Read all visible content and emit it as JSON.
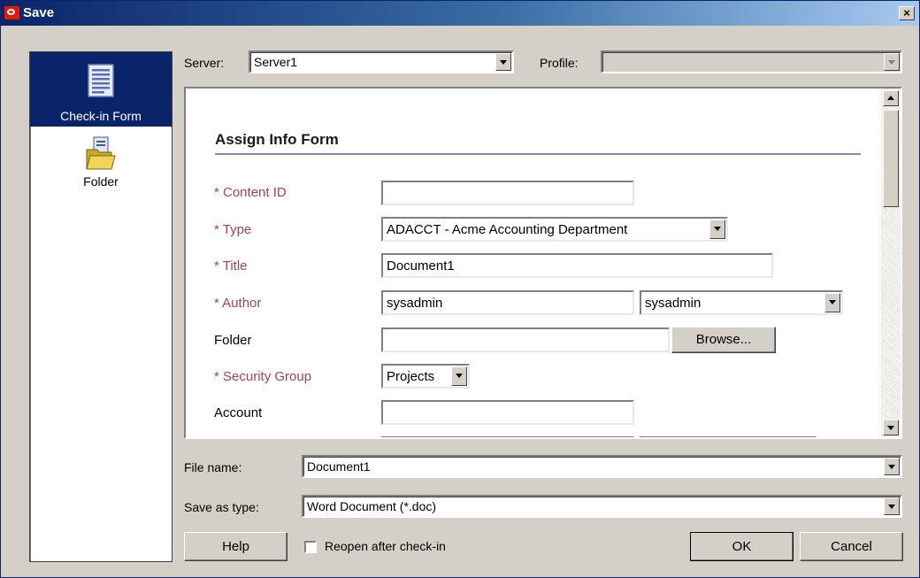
{
  "window": {
    "title": "Save",
    "close_glyph": "×"
  },
  "sidebar": {
    "items": [
      {
        "label": "Check-in Form",
        "icon": "form-icon",
        "selected": true
      },
      {
        "label": "Folder",
        "icon": "folder-icon",
        "selected": false
      }
    ]
  },
  "top": {
    "server_label": "Server:",
    "server_value": "Server1",
    "profile_label": "Profile:",
    "profile_value": ""
  },
  "form": {
    "heading": "Assign Info Form",
    "fields": {
      "content_id": {
        "label": "* Content ID",
        "value": ""
      },
      "type": {
        "label": "* Type",
        "value": "ADACCT - Acme Accounting Department"
      },
      "title": {
        "label": "* Title",
        "value": "Document1"
      },
      "author": {
        "label": "* Author",
        "value": "sysadmin",
        "select_value": "sysadmin"
      },
      "folder": {
        "label": "Folder",
        "value": "",
        "browse_label": "Browse..."
      },
      "security_group": {
        "label": "* Security Group",
        "value": "Projects"
      },
      "account": {
        "label": "Account",
        "value": ""
      }
    }
  },
  "bottom": {
    "file_name_label": "File name:",
    "file_name_value": "Document1",
    "save_as_type_label": "Save as type:",
    "save_as_type_value": "Word Document (*.doc)",
    "help_label": "Help",
    "reopen_label": "Reopen after check-in",
    "reopen_checked": false,
    "ok_label": "OK",
    "cancel_label": "Cancel"
  },
  "colors": {
    "title_bar": "#0a246a",
    "selected_item": "#0a246a",
    "required_label": "#a0454d",
    "dialog_bg": "#d4d0c8"
  }
}
